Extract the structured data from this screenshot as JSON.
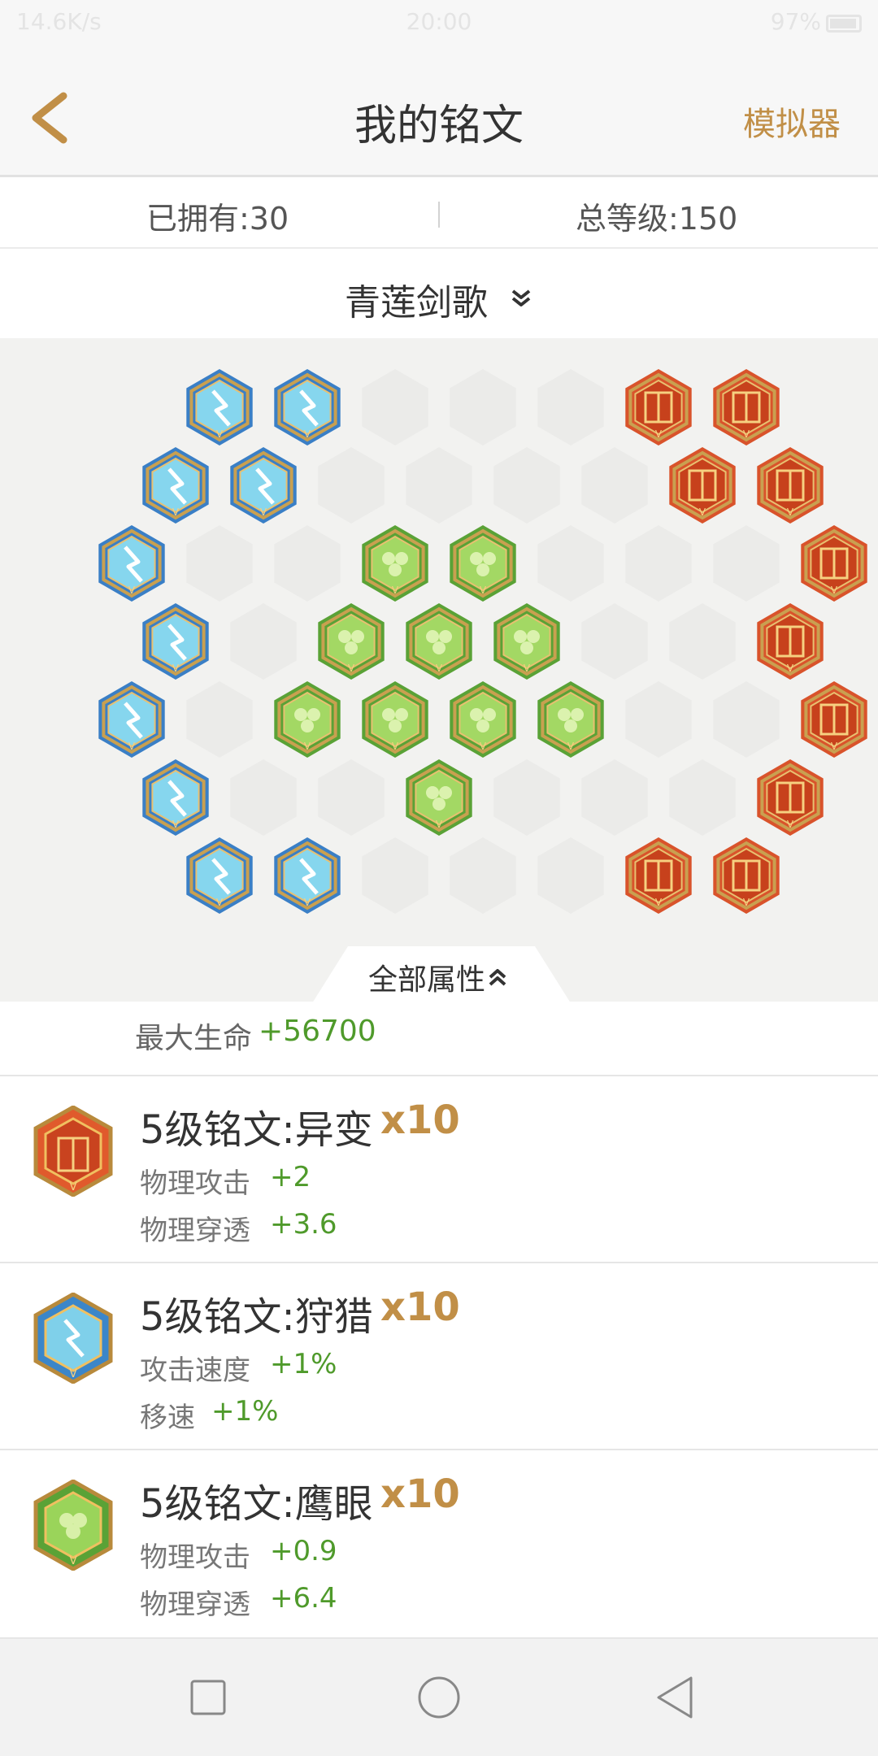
{
  "status_bar": {
    "left": "14.6K/s",
    "time": "20:00",
    "battery": "97%"
  },
  "header": {
    "title": "我的铭文",
    "simulator_label": "模拟器"
  },
  "stats": {
    "owned": "已拥有:30",
    "total_level": "总等级:150"
  },
  "selector": {
    "label": "青莲剑歌"
  },
  "attributes_tab": {
    "label": "全部属性"
  },
  "summary": {
    "label": "最大生命",
    "value": "+56700"
  },
  "colors": {
    "accent": "#c18f47",
    "positive": "#4f9a2b",
    "red_rune": "#d9532b",
    "blue_rune": "#3a7fc6",
    "green_rune": "#5aa236"
  },
  "runes": [
    {
      "icon": "red-rune-icon",
      "name": "5级铭文:异变",
      "count": "x10",
      "attrs": [
        {
          "label": "物理攻击",
          "value": "+2"
        },
        {
          "label": "物理穿透",
          "value": "+3.6"
        }
      ]
    },
    {
      "icon": "blue-rune-icon",
      "name": "5级铭文:狩猎",
      "count": "x10",
      "attrs": [
        {
          "label": "攻击速度",
          "value": "+1%"
        },
        {
          "label": "移速",
          "value": "+1%"
        }
      ]
    },
    {
      "icon": "green-rune-icon",
      "name": "5级铭文:鹰眼",
      "count": "x10",
      "attrs": [
        {
          "label": "物理攻击",
          "value": "+0.9"
        },
        {
          "label": "物理穿透",
          "value": "+6.4"
        }
      ]
    }
  ],
  "nav": {
    "recent": "square-icon",
    "home": "circle-icon",
    "back": "triangle-back-icon"
  }
}
